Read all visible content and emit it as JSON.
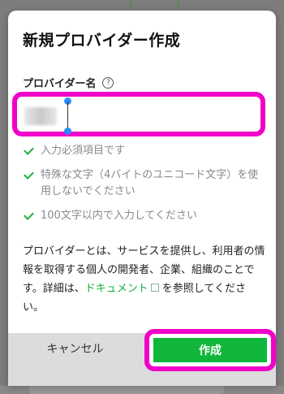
{
  "dialog": {
    "title": "新規プロバイダー作成",
    "field_label": "プロバイダー名",
    "help_icon": "?",
    "input_value": "",
    "rules": [
      "入力必須項目です",
      "特殊な文字（4バイトのユニコード文字）を使用しないでください",
      "100文字以内で入力してください"
    ],
    "description_before_link": "プロバイダーとは、サービスを提供し、利用者の情報を取得する個人の開発者、企業、組織のことです。詳細は、",
    "description_link": "ドキュメント",
    "description_after_link": "を参照してください。",
    "cancel_label": "キャンセル",
    "create_label": "作成"
  },
  "colors": {
    "accent_green": "#11b73a",
    "highlight_magenta": "#f000c8",
    "link_green": "#16b03a"
  }
}
